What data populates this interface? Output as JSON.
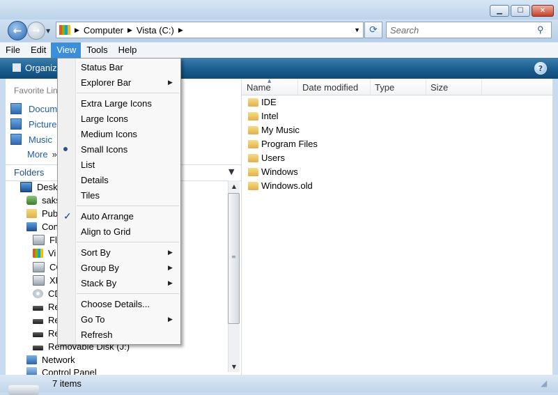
{
  "address": {
    "segments": [
      "Computer",
      "Vista (C:)"
    ]
  },
  "search": {
    "placeholder": "Search"
  },
  "menubar": [
    "File",
    "Edit",
    "View",
    "Tools",
    "Help"
  ],
  "toolbar": {
    "organize": "Organiz"
  },
  "favorites": {
    "title": "Favorite Lin",
    "items": [
      "Docume",
      "Pictures",
      "Music"
    ],
    "more": "More"
  },
  "folders": {
    "title": "Folders"
  },
  "tree": [
    "Deskt",
    "saks",
    "Pub",
    "Con",
    "Flo",
    "Vi",
    "CO",
    "XP",
    "CD",
    "Re",
    "Re",
    "Re",
    "Removable Disk (J:)",
    "Network",
    "Control Panel"
  ],
  "columns": [
    "Name",
    "Date modified",
    "Type",
    "Size"
  ],
  "files": [
    "IDE",
    "Intel",
    "My Music",
    "Program Files",
    "Users",
    "Windows",
    "Windows.old"
  ],
  "status": {
    "items": "7 items"
  },
  "view_menu": {
    "groups": [
      [
        "Status Bar",
        "Explorer Bar"
      ],
      [
        "Extra Large Icons",
        "Large Icons",
        "Medium Icons",
        "Small Icons",
        "List",
        "Details",
        "Tiles"
      ],
      [
        "Auto Arrange",
        "Align to Grid"
      ],
      [
        "Sort By",
        "Group By",
        "Stack By"
      ],
      [
        "Choose Details...",
        "Go To",
        "Refresh"
      ]
    ]
  }
}
